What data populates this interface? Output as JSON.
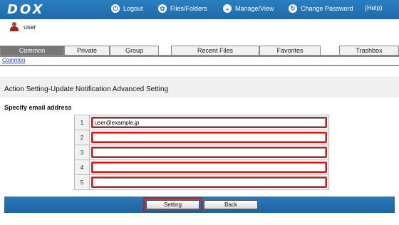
{
  "app": {
    "logo": "DOX"
  },
  "nav": [
    {
      "icon": "logout-icon",
      "glyph": "⏻",
      "label": "Logout"
    },
    {
      "icon": "files-folders-icon",
      "glyph": "✿",
      "label": "Files/Folders"
    },
    {
      "icon": "manage-view-icon",
      "glyph": "◒",
      "label": "Manage/View"
    },
    {
      "icon": "change-password-icon",
      "glyph": "↻",
      "label": "Change Password"
    },
    {
      "icon": "help-icon",
      "glyph": "?",
      "label": "Help",
      "label_prefix": "(",
      "label_suffix": ")"
    }
  ],
  "user": {
    "name": "user"
  },
  "tabs": {
    "common": "Common",
    "private": "Private",
    "group": "Group",
    "recent_files": "Recent Files",
    "favorites": "Favorites",
    "trashbox": "Trashbox"
  },
  "breadcrumb": "Common",
  "page": {
    "title": "Action Setting-Update Notification Advanced Setting",
    "subtitle": "Specify email address"
  },
  "emails": [
    {
      "num": "1",
      "value": "user@example.jp"
    },
    {
      "num": "2",
      "value": ""
    },
    {
      "num": "3",
      "value": ""
    },
    {
      "num": "4",
      "value": ""
    },
    {
      "num": "5",
      "value": ""
    }
  ],
  "buttons": {
    "setting": "Setting",
    "back": "Back"
  },
  "colors": {
    "header": "#1f6aa8",
    "highlight": "#e01010",
    "active_tab": "#777777"
  }
}
